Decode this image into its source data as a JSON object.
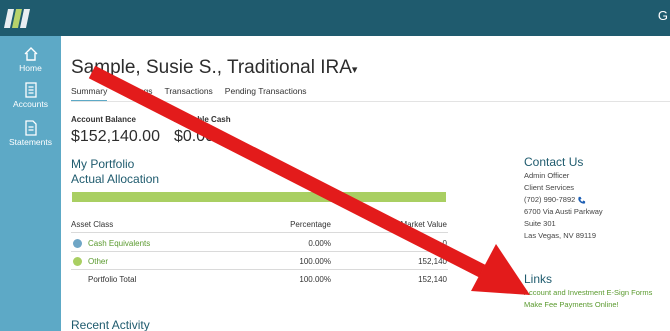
{
  "header": {
    "user_initial": "G"
  },
  "sidebar": {
    "items": [
      {
        "label": "Home",
        "icon": "home-icon"
      },
      {
        "label": "Accounts",
        "icon": "accounts-icon"
      },
      {
        "label": "Statements",
        "icon": "statements-icon"
      }
    ]
  },
  "account": {
    "title": "Sample, Susie S., Traditional IRA",
    "title_caret": "▾",
    "tabs": [
      "Summary",
      "Holdings",
      "Transactions",
      "Pending Transactions"
    ],
    "active_tab": "Summary"
  },
  "balances": {
    "account_balance_label": "Account Balance",
    "account_balance_value": "$152,140.00",
    "available_cash_label": "Available Cash",
    "available_cash_value": "$0.00"
  },
  "portfolio": {
    "title": "My Portfolio",
    "subtitle": "Actual Allocation",
    "allocation_fill_fraction": 1.0,
    "headers": [
      "Asset Class",
      "Percentage",
      "Market Value"
    ],
    "rows": [
      {
        "name": "Cash Equivalents",
        "percentage": "0.00%",
        "value": "0",
        "dot_color": "#6fa6c6"
      },
      {
        "name": "Other",
        "percentage": "100.00%",
        "value": "152,140",
        "dot_color": "#a9cf62"
      }
    ],
    "total": {
      "name": "Portfolio Total",
      "percentage": "100.00%",
      "value": "152,140"
    }
  },
  "contact": {
    "title": "Contact Us",
    "lines": [
      "Admin Officer",
      "Client Services",
      "(702) 990-7892",
      "6700 Via Austi Parkway",
      "Suite 301",
      "Las Vegas, NV 89119"
    ]
  },
  "links": {
    "title": "Links",
    "items": [
      "Account and Investment E-Sign Forms",
      "Make Fee Payments Online!"
    ]
  },
  "recent_activity": {
    "title": "Recent Activity"
  },
  "colors": {
    "topbar": "#1f5b6e",
    "sidebar": "#5da9c6",
    "accent_green": "#a9cf62",
    "arrow_red": "#e31b1b"
  }
}
